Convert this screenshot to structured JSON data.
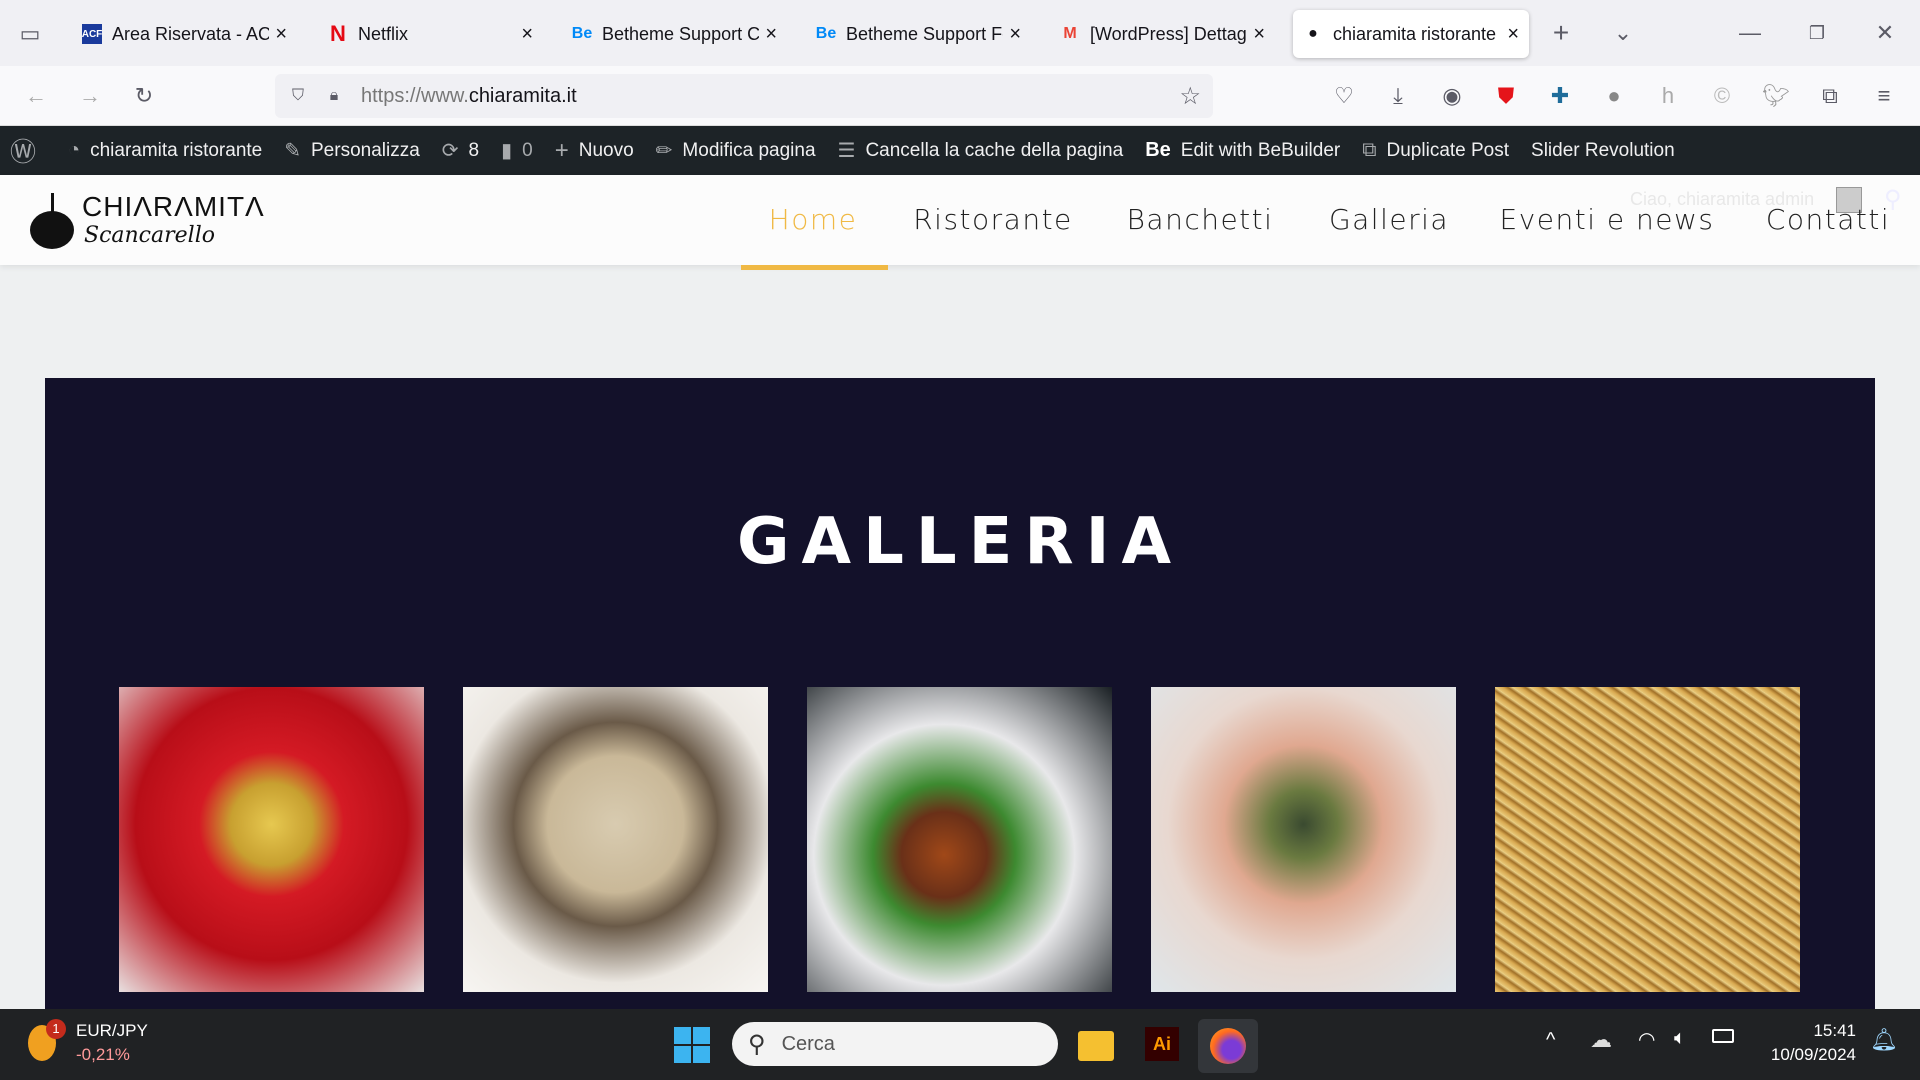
{
  "browser": {
    "tabs": [
      {
        "title": "Area Riservata - ACF",
        "icon": "acf-icon"
      },
      {
        "title": "Netflix",
        "icon": "netflix-icon"
      },
      {
        "title": "Betheme Support Ce",
        "icon": "be-icon"
      },
      {
        "title": "Betheme Support Fo",
        "icon": "be-icon"
      },
      {
        "title": "[WordPress] Dettagl",
        "icon": "gmail-icon"
      },
      {
        "title": "chiaramita ristorante",
        "icon": "site-favicon",
        "active": true
      }
    ],
    "url_prefix": "https://www.",
    "url_domain": "chiaramita.it"
  },
  "wpbar": {
    "site": "chiaramita ristorante",
    "customize": "Personalizza",
    "updates": "8",
    "comments": "0",
    "new": "Nuovo",
    "edit": "Modifica pagina",
    "cache": "Cancella la cache della pagina",
    "bebuilder": "Edit with BeBuilder",
    "duplicate": "Duplicate Post",
    "slider": "Slider Revolution"
  },
  "site": {
    "logo_top": "CHIΛRΛMITΛ",
    "logo_bottom": "Scancarello",
    "greeting": "Ciao, chiaramita admin",
    "nav": [
      "Home",
      "Ristorante",
      "Banchetti",
      "Galleria",
      "Eventi e news",
      "Contatti"
    ],
    "active_nav": "Home",
    "accent": "#f0b944",
    "section_title": "GALLERIA",
    "section_bg": "#13112a",
    "gallery": [
      "carpaccio",
      "pasta-mushrooms",
      "tartare-plate",
      "roll-vegetables",
      "fresh-pasta"
    ]
  },
  "taskbar": {
    "ticker": "EUR/JPY",
    "change": "-0,21%",
    "badge": "1",
    "search": "Cerca",
    "time": "15:41",
    "date": "10/09/2024"
  }
}
